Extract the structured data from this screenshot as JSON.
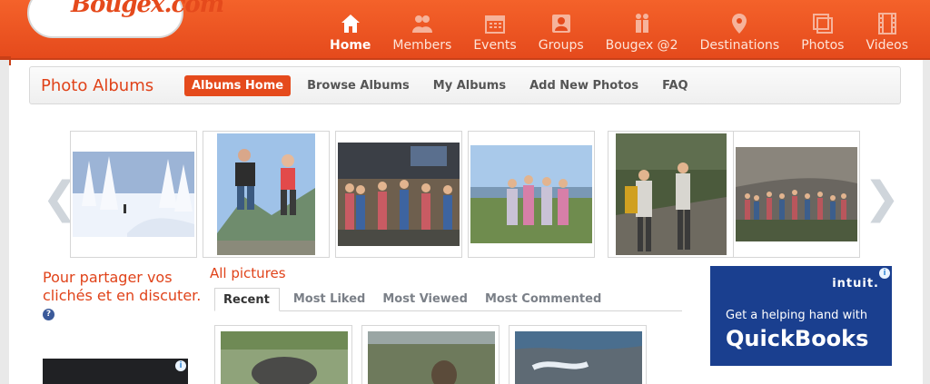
{
  "logo": {
    "text": "Bougex.com"
  },
  "nav": {
    "items": [
      {
        "label": "Home",
        "icon": "home-icon"
      },
      {
        "label": "Members",
        "icon": "members-icon"
      },
      {
        "label": "Events",
        "icon": "calendar-icon"
      },
      {
        "label": "Groups",
        "icon": "groups-icon"
      },
      {
        "label": "Bougex @2",
        "icon": "couple-icon"
      },
      {
        "label": "Destinations",
        "icon": "map-pin-icon"
      },
      {
        "label": "Photos",
        "icon": "photos-icon"
      },
      {
        "label": "Videos",
        "icon": "film-icon"
      }
    ],
    "active": "Home"
  },
  "subnav": {
    "title": "Photo Albums",
    "links": [
      "Albums Home",
      "Browse Albums",
      "My Albums",
      "Add New Photos",
      "FAQ"
    ]
  },
  "carousel": {
    "prev_icon": "chevron-left-icon",
    "next_icon": "chevron-right-icon",
    "photos": [
      "snowy forest",
      "two people jumping",
      "group at lodge",
      "group on summit",
      "hikers on trail",
      "large group on rocks"
    ]
  },
  "promo": {
    "text": "Pour partager vos clichés et en discuter.",
    "help": "?"
  },
  "all_pictures": {
    "title": "All pictures",
    "tabs": [
      "Recent",
      "Most Liked",
      "Most Viewed",
      "Most Commented"
    ]
  },
  "ad_right": {
    "brand": "intuit.",
    "line1": "Get a helping hand with",
    "line2": "QuickBooks"
  },
  "ad_info": "i",
  "colors": {
    "brand": "#e54a1c",
    "nav_bar": "#f4622a",
    "ad_blue": "#1a3f8f"
  }
}
